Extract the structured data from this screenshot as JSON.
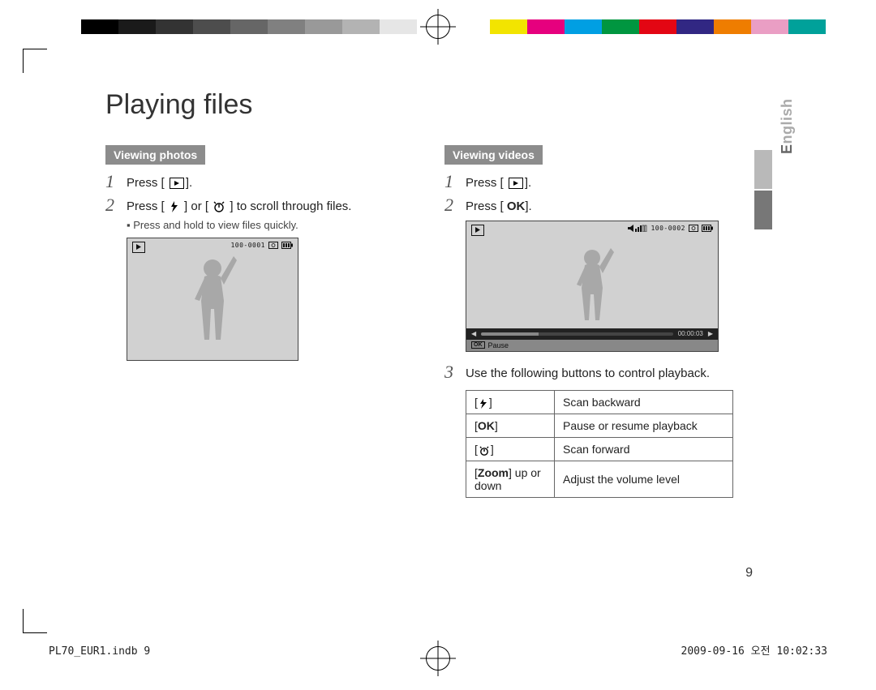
{
  "title": "Playing files",
  "side_tab": {
    "highlight": "E",
    "rest": "nglish"
  },
  "icons": {
    "ok": "OK"
  },
  "photos": {
    "heading": "Viewing photos",
    "steps": [
      {
        "num": "1",
        "pre": "Press [",
        "post": "]."
      },
      {
        "num": "2",
        "p1": "Press [",
        "p2": "] or [",
        "p3": "] to scroll through files."
      }
    ],
    "note": "Press and hold to view files quickly.",
    "lcd": {
      "counter": "100-0001"
    }
  },
  "videos": {
    "heading": "Viewing videos",
    "steps": [
      {
        "num": "1",
        "pre": "Press [",
        "post": "]."
      },
      {
        "num": "2",
        "pre": "Press [",
        "post": "]."
      },
      {
        "num": "3",
        "text": "Use the following buttons to control playback."
      }
    ],
    "lcd": {
      "counter": "100-0002",
      "time": "00:00:03",
      "pause": "Pause"
    },
    "table": [
      {
        "desc": "Scan backward"
      },
      {
        "desc": "Pause or resume playback"
      },
      {
        "desc": "Scan forward"
      },
      {
        "key_bold": "Zoom",
        "key_rest": "up or down",
        "desc": "Adjust the volume level"
      }
    ]
  },
  "page_number": "9",
  "footer": {
    "left": "PL70_EUR1.indb   9",
    "right": "2009-09-16   오전 10:02:33"
  }
}
